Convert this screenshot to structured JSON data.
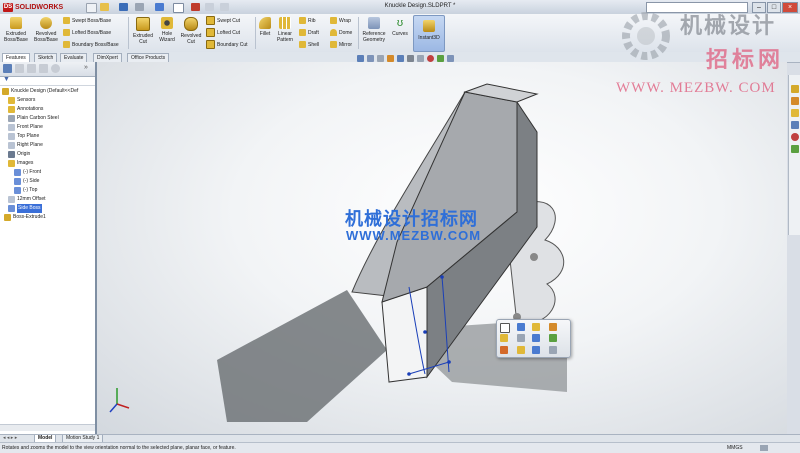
{
  "app": {
    "logo_text": "SOLIDWORKS",
    "document_title": "Knuckle Design.SLDPRT *"
  },
  "ribbon": {
    "extruded_boss": "Extruded Boss/Base",
    "revolved_boss": "Revolved Boss/Base",
    "swept_boss": "Swept Boss/Base",
    "lofted_boss": "Lofted Boss/Base",
    "boundary_boss": "Boundary Boss/Base",
    "extruded_cut": "Extruded Cut",
    "hole_wizard": "Hole Wizard",
    "revolved_cut": "Revolved Cut",
    "swept_cut": "Swept Cut",
    "lofted_cut": "Lofted Cut",
    "boundary_cut": "Boundary Cut",
    "fillet": "Fillet",
    "linear_pattern": "Linear Pattern",
    "rib": "Rib",
    "draft": "Draft",
    "shell": "Shell",
    "wrap": "Wrap",
    "dome": "Dome",
    "mirror": "Mirror",
    "reference_geometry": "Reference Geometry",
    "curves": "Curves",
    "instant3d": "Instant3D"
  },
  "tabs": [
    "Features",
    "Sketch",
    "Evaluate",
    "DimXpert",
    "Office Products"
  ],
  "tree": {
    "root": "Knuckle Design  (Default<<Def",
    "items": [
      {
        "label": "Sensors",
        "icon": "sensor-icon"
      },
      {
        "label": "Annotations",
        "icon": "annotation-icon"
      },
      {
        "label": "Plain Carbon Steel",
        "icon": "material-icon"
      },
      {
        "label": "Front Plane",
        "icon": "plane-icon"
      },
      {
        "label": "Top Plane",
        "icon": "plane-icon"
      },
      {
        "label": "Right Plane",
        "icon": "plane-icon"
      },
      {
        "label": "Origin",
        "icon": "origin-icon"
      },
      {
        "label": "Images",
        "icon": "folder-icon"
      },
      {
        "label": "(-) Front",
        "icon": "sketch-icon"
      },
      {
        "label": "(-) Side",
        "icon": "sketch-icon"
      },
      {
        "label": "(-) Top",
        "icon": "sketch-icon"
      },
      {
        "label": "12mm Offset",
        "icon": "plane-icon"
      },
      {
        "label": "Side Boss",
        "icon": "sketch-icon"
      },
      {
        "label": "Boss-Extrude1",
        "icon": "extrude-icon"
      }
    ]
  },
  "watermark": {
    "line1": "机械设计",
    "line2": "招标网",
    "url": "WWW. MEZBW. COM",
    "mid_line1": "机械设计招标网",
    "mid_url": "WWW.MEZBW.COM"
  },
  "bottom_tabs": [
    "Model",
    "Motion Study 1"
  ],
  "status": {
    "message": "Rotates and zooms the model to the view orientation normal to the selected plane, planar face, or feature.",
    "units": "MMGS"
  },
  "colors": {
    "accent": "#3a6fd8",
    "watermark_pink": "#e06080"
  }
}
